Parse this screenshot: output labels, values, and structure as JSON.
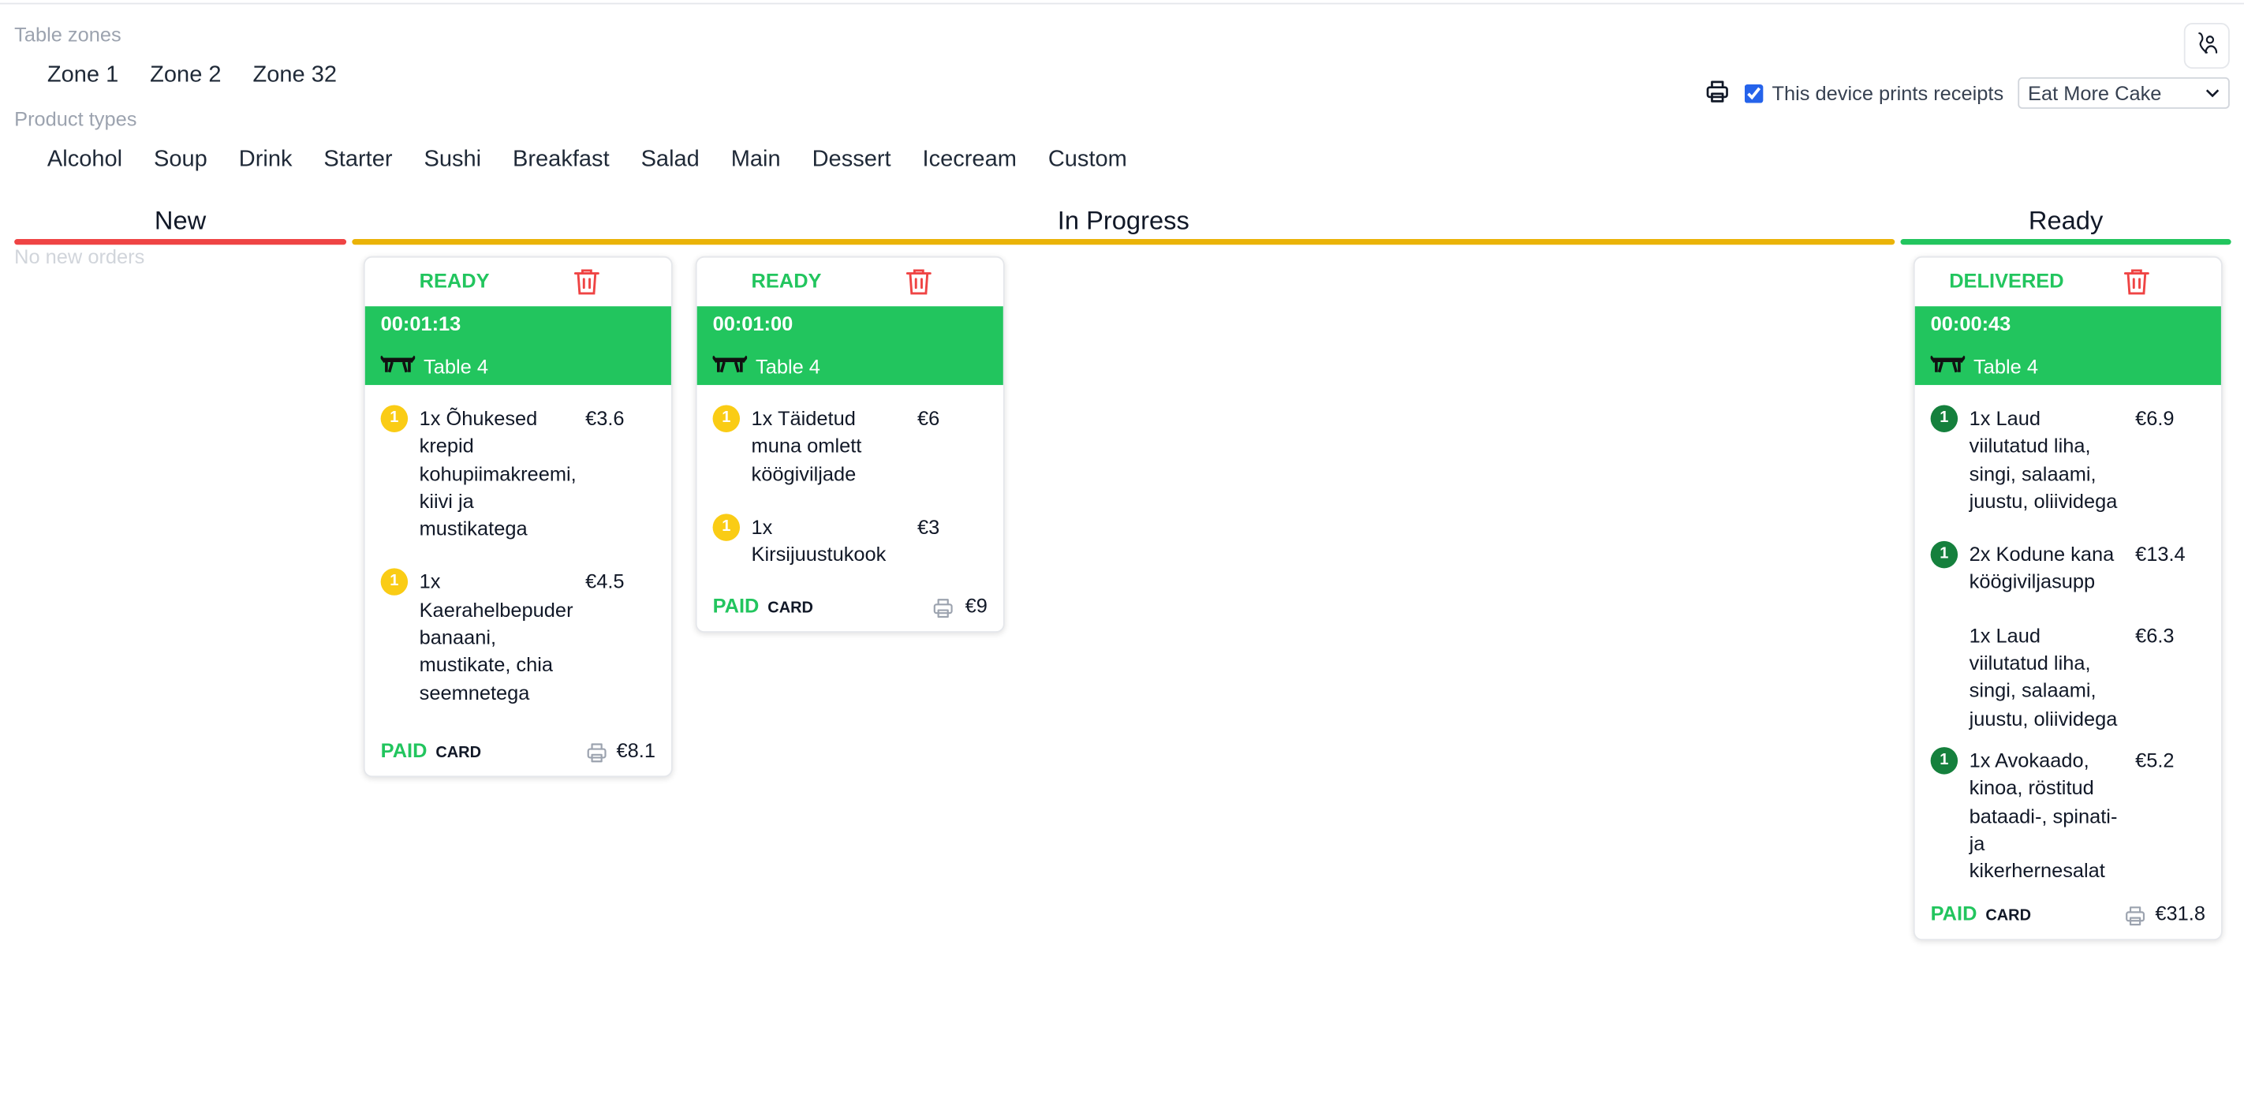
{
  "zones": {
    "label": "Table zones",
    "items": [
      "Zone 1",
      "Zone 2",
      "Zone 32"
    ]
  },
  "product_types": {
    "label": "Product types",
    "items": [
      "Alcohol",
      "Soup",
      "Drink",
      "Starter",
      "Sushi",
      "Breakfast",
      "Salad",
      "Main",
      "Dessert",
      "Icecream",
      "Custom"
    ]
  },
  "printer": {
    "checkbox_label": "This device prints receipts",
    "checked": true,
    "selected_option": "Eat More Cake"
  },
  "columns": {
    "new": {
      "title": "New",
      "color": "#ef4444",
      "empty_text": "No new orders"
    },
    "in_progress": {
      "title": "In Progress",
      "color": "#eab308"
    },
    "ready": {
      "title": "Ready",
      "color": "#22c55e"
    }
  },
  "orders": [
    {
      "status": "READY",
      "timer": "00:01:13",
      "table": "Table 4",
      "items": [
        {
          "qty_badge": "1",
          "name": "1x Õhukesed krepid kohupiimakreemi, kiivi ja mustikatega",
          "price": "€3.6"
        },
        {
          "qty_badge": "1",
          "name": "1x Kaerahelbepuder banaani, mustikate, chia seemnetega",
          "price": "€4.5"
        }
      ],
      "paid": "PAID",
      "method": "CARD",
      "total": "€8.1"
    },
    {
      "status": "READY",
      "timer": "00:01:00",
      "table": "Table 4",
      "items": [
        {
          "qty_badge": "1",
          "name": "1x Täidetud muna omlett köögiviljade",
          "price": "€6"
        },
        {
          "qty_badge": "1",
          "name": "1x Kirsijuustukook",
          "price": "€3"
        }
      ],
      "paid": "PAID",
      "method": "CARD",
      "total": "€9"
    },
    {
      "status": "DELIVERED",
      "timer": "00:00:43",
      "table": "Table 4",
      "items": [
        {
          "qty_badge": "1",
          "name": "1x Laud viilutatud liha, singi, salaami, juustu, oliividega",
          "price": "€6.9"
        },
        {
          "qty_badge": "1",
          "name": "2x Kodune kana köögiviljasupp",
          "price": "€13.4"
        },
        {
          "qty_badge": "",
          "name": "1x Laud viilutatud liha, singi, salaami, juustu, oliividega",
          "price": "€6.3"
        },
        {
          "qty_badge": "1",
          "name": "1x Avokaado, kinoa, röstitud bataadi-, spinati- ja kikerhernesalat",
          "price": "€5.2"
        }
      ],
      "paid": "PAID",
      "method": "CARD",
      "total": "€31.8"
    }
  ]
}
